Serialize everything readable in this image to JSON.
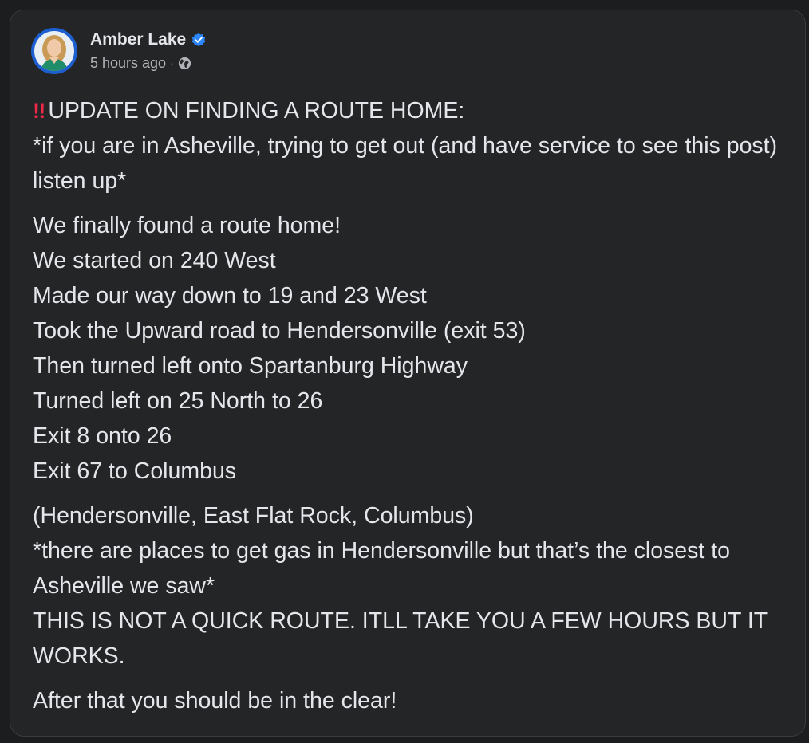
{
  "post": {
    "author": "Amber Lake",
    "verified": true,
    "timestamp": "5 hours ago",
    "separator": "·",
    "audience_icon": "globe-icon",
    "headline_icon": "double-exclamation-icon",
    "headline_icon_glyph": "‼",
    "paragraphs": [
      {
        "lines": [
          "UPDATE ON FINDING A ROUTE HOME:",
          "*if you are in Asheville, trying to get out (and have service to see this post) listen up*"
        ]
      },
      {
        "lines": [
          "We finally found a route home!",
          "We started on 240 West",
          "Made our way down to 19 and 23 West",
          "Took the Upward road to Hendersonville (exit 53)",
          "Then turned left onto Spartanburg Highway",
          "Turned left on 25 North to 26",
          "Exit 8 onto 26",
          "Exit 67 to Columbus"
        ]
      },
      {
        "lines": [
          "(Hendersonville, East Flat Rock, Columbus)",
          "*there are places to get gas in Hendersonville but that’s the closest to Asheville we saw*",
          "THIS IS NOT A QUICK ROUTE. ITLL TAKE YOU A FEW HOURS BUT IT WORKS."
        ]
      },
      {
        "lines": [
          "After that you should be in the clear!"
        ]
      }
    ]
  },
  "colors": {
    "background": "#1c1d1f",
    "card": "#242526",
    "text_primary": "#e4e6eb",
    "text_secondary": "#b0b3b8",
    "verified_blue": "#2d88ff",
    "alert_red": "#f02849"
  }
}
